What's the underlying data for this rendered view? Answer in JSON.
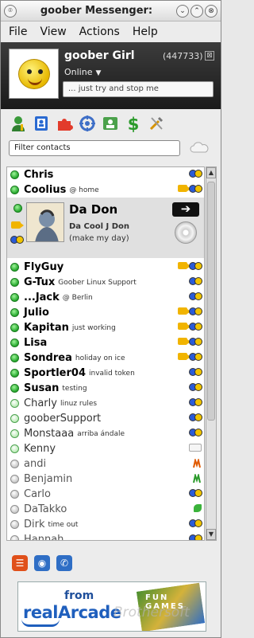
{
  "window": {
    "title": "goober Messenger:",
    "buttons": {
      "menu": "⌾",
      "minimize": "⌄",
      "maximize": "⌃",
      "close": "⊗"
    }
  },
  "menu": [
    "File",
    "View",
    "Actions",
    "Help"
  ],
  "profile": {
    "name": "goober Girl",
    "number": "(447733)",
    "close": "⊠",
    "status": "Online",
    "status_caret": "▼",
    "message": "... just try and stop me"
  },
  "toolbar": {
    "icons": [
      "add-contact-icon",
      "address-book-icon",
      "puzzle-icon",
      "settings-wheel-icon",
      "contacts-icon",
      "dollar-icon",
      "tools-icon"
    ]
  },
  "filter": {
    "placeholder": "Filter contacts"
  },
  "contacts": {
    "chris": {
      "name": "Chris"
    },
    "coolius": {
      "name": "Coolius",
      "sub": "@ home"
    },
    "dadon": {
      "name": "Da Don",
      "line1": "Da Cool J Don",
      "line2": "(make my day)",
      "arrow": "➔"
    },
    "flyguy": {
      "name": "FlyGuy"
    },
    "gtux": {
      "name": "G-Tux",
      "sub": "Goober Linux Support"
    },
    "jack": {
      "name": "...Jack",
      "sub": "@ Berlin"
    },
    "julio": {
      "name": "Julio"
    },
    "kapitan": {
      "name": "Kapitan",
      "sub": "just working"
    },
    "lisa": {
      "name": "Lisa"
    },
    "sondrea": {
      "name": "Sondrea",
      "sub": "holiday on ice"
    },
    "sportler": {
      "name": "Sportler04",
      "sub": "invalid token"
    },
    "susan": {
      "name": "Susan",
      "sub": "testing"
    },
    "charly": {
      "name": "Charly",
      "sub": "linuz rules"
    },
    "goobersupport": {
      "name": "gooberSupport"
    },
    "monstaaa": {
      "name": "Monstaaa",
      "sub": "arriba ándale"
    },
    "kenny": {
      "name": "Kenny"
    },
    "andi": {
      "name": "andi"
    },
    "benjamin": {
      "name": "Benjamin"
    },
    "carlo": {
      "name": "Carlo"
    },
    "datakko": {
      "name": "DaTakko"
    },
    "dirk": {
      "name": "Dirk",
      "sub": "time out"
    },
    "hannah": {
      "name": "Hannah"
    }
  },
  "scrollbar": {
    "up": "▲",
    "down": "▼"
  },
  "bottom": {
    "list": "☰",
    "rss": "◉",
    "phone": "✆"
  },
  "ad": {
    "from": "from",
    "logo_a": "real",
    "logo_b": "Arcade",
    "tiles": "FUN GAMES"
  },
  "watermark": "Brothersoft"
}
